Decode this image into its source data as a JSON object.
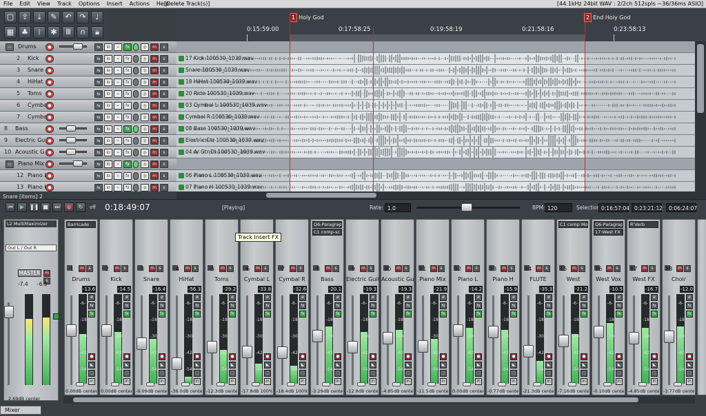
{
  "menu": {
    "items": [
      "File",
      "Edit",
      "View",
      "Track",
      "Options",
      "Insert",
      "Actions",
      "Help"
    ],
    "title": "[Delete Track(s)]",
    "status": "[44.1kHz 24bit WAV : 2/2ch 512spls ~36/36ms ASIO]"
  },
  "toolbar": {
    "icons": [
      "new-project-icon",
      "open-project-icon",
      "save-project-icon",
      "project-settings-icon",
      "undo-icon",
      "redo-icon",
      "metronome-icon",
      "grid-icon",
      "snap-icon",
      "ripple-icon",
      "mixer-icon",
      "routing-icon",
      "loop-icon",
      "lock-icon"
    ]
  },
  "ruler": {
    "markers": [
      {
        "num": "1",
        "label": "Holy God"
      },
      {
        "num": "2",
        "label": "End Holy God"
      }
    ],
    "times": [
      "0:15:59:00",
      "0:17:58:25",
      "0:19:58:19",
      "0:21:58:16",
      "0:23:58:13"
    ]
  },
  "tracks": [
    {
      "num": "1",
      "name": "Drums",
      "folder": true
    },
    {
      "num": "2",
      "name": "Kick",
      "item": "17 Kick 100530_1039.wav"
    },
    {
      "num": "3",
      "name": "Snare",
      "item": "Snare 100530_1039.wav"
    },
    {
      "num": "4",
      "name": "HiHat",
      "item": "18 HiHat 100530_1039.wav"
    },
    {
      "num": "5",
      "name": "Toms",
      "item": "20 Ride 100530_1039.wav"
    },
    {
      "num": "6",
      "name": "Cymbal L",
      "item": "03 Cymbal L 100530_1039.wav"
    },
    {
      "num": "7",
      "name": "Cymbal R",
      "item": "Cymbal R 100530_1039.wav"
    },
    {
      "num": "8",
      "name": "Bass",
      "item": "08 Bass 100530_1039.wav"
    },
    {
      "num": "9",
      "name": "Electric Gu",
      "item": "Electric Gtr 100530_1039.wav"
    },
    {
      "num": "10",
      "name": "Acoustic G",
      "item": "04 A/ Gtr DI 100530_1039.wav"
    },
    {
      "num": "11",
      "name": "Piano Mix",
      "folder": true
    },
    {
      "num": "12",
      "name": "Piano L",
      "item": "06 Piano L 100530_1039.wav"
    },
    {
      "num": "13",
      "name": "Piano H",
      "item": "07 Piano H 100530_1039.wav"
    }
  ],
  "transport": {
    "status_bottom": "Snare [items] 2",
    "time": "0:18:49:07",
    "state": "[Playing]",
    "rate_label": "Rate:",
    "rate": "1.0",
    "bpm_label": "BPM:",
    "bpm": "120",
    "selection_label": "Selection:",
    "sel_start": "0:16:57:04",
    "sel_end": "0:23:21:12",
    "sel_len": "0:06:24:07",
    "repeat_label": "off"
  },
  "master": {
    "fx": "L2 MultiMaximizer",
    "routing": "Out L / Out R",
    "label": "MASTER",
    "peak_l": "-7.4",
    "peak_r": "-6.5",
    "vol": "2.69dB center"
  },
  "tooltip": "Track Insert FX",
  "mixer_tab": "Mixer",
  "strips": [
    {
      "num": "1",
      "name": "Drums",
      "fx": "Barricade",
      "peak": "-13.6",
      "vol": "0.00dB center",
      "level": 0.55,
      "fader": 0.62
    },
    {
      "num": "2",
      "name": "Kick",
      "fx": "",
      "peak": "-14.5",
      "vol": "0.00dB center",
      "level": 0.58,
      "fader": 0.62
    },
    {
      "num": "3",
      "name": "Snare",
      "fx": "",
      "peak": "-16.4",
      "vol": "-9.09dB center",
      "level": 0.5,
      "fader": 0.45
    },
    {
      "num": "4",
      "name": "HiHat",
      "fx": "",
      "peak": "-56.3",
      "vol": "-36.0dB center",
      "level": 0.08,
      "fader": 0.18
    },
    {
      "num": "5",
      "name": "Toms",
      "fx": "",
      "peak": "-29.2",
      "vol": "-12.3dB center",
      "level": 0.38,
      "fader": 0.4
    },
    {
      "num": "6",
      "name": "Cymbal L",
      "fx": "",
      "peak": "-33.8",
      "vol": "-17.8dB 100%L",
      "level": 0.22,
      "fader": 0.34
    },
    {
      "num": "7",
      "name": "Cymbal R",
      "fx": "",
      "peak": "-32.6",
      "vol": "-18.4dB 100%R",
      "level": 0.2,
      "fader": 0.33
    },
    {
      "num": "8",
      "name": "Bass",
      "fx": "Q6-Paragraphic",
      "fx2": "C1 comp-sc",
      "peak": "-20.1",
      "vol": "-3.29dB center",
      "level": 0.64,
      "fader": 0.55
    },
    {
      "num": "9",
      "name": "Electric Guita",
      "fx": "",
      "peak": "-19.3",
      "vol": "-12.8dB center",
      "level": 0.58,
      "fader": 0.4
    },
    {
      "num": "10",
      "name": "Acoustic Guit",
      "fx": "",
      "peak": "-19.3",
      "vol": "-4.85dB center",
      "level": 0.6,
      "fader": 0.52
    },
    {
      "num": "11",
      "name": "Piano Mix",
      "fx": "",
      "peak": "-21.9",
      "vol": "-11.5dB center",
      "level": 0.5,
      "fader": 0.41
    },
    {
      "num": "12",
      "name": "Piano L",
      "fx": "",
      "peak": "-14.2",
      "vol": "0.00dB center",
      "level": 0.62,
      "fader": 0.62
    },
    {
      "num": "13",
      "name": "Piano H",
      "fx": "",
      "peak": "-15.9",
      "vol": "-0.77dB center",
      "level": 0.6,
      "fader": 0.6
    },
    {
      "num": "14",
      "name": "FLUTE",
      "fx": "",
      "peak": "-35.3",
      "vol": "-21.3dB center",
      "level": 0.25,
      "fader": 0.35
    },
    {
      "num": "15",
      "name": "West",
      "fx": "C1 comp Mono",
      "peak": "-21.2",
      "vol": "-7.16dB center",
      "level": 0.55,
      "fader": 0.48
    },
    {
      "num": "16",
      "name": "West Vox",
      "fx": "Q6-Paragraphic",
      "fx2": "17:West FX",
      "peak": "-10.5",
      "vol": "-0.10dB center",
      "level": 0.68,
      "fader": 0.6
    },
    {
      "num": "17",
      "name": "West FX",
      "fx": "R'Verb",
      "peak": "-16.7",
      "vol": "-4.85dB center",
      "level": 0.62,
      "fader": 0.52
    },
    {
      "num": "18",
      "name": "Choir",
      "fx": "",
      "peak": "-12.0",
      "vol": "-3.77dB center",
      "level": 0.64,
      "fader": 0.54
    }
  ],
  "strip_scale": [
    "-6-",
    "-18-",
    "-30-",
    "-42-",
    "-54-"
  ],
  "colors": {
    "accent_green": "#39a34a",
    "mute_red": "#8a2e35",
    "marker_red": "#b33"
  }
}
